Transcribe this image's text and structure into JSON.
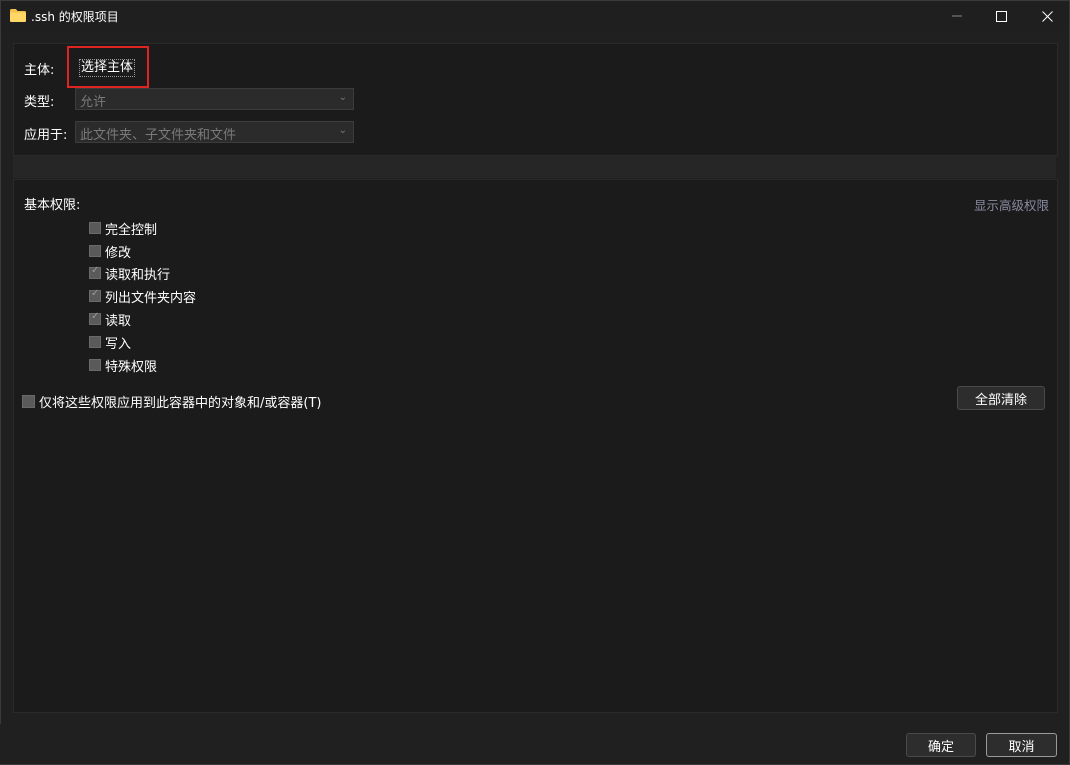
{
  "window": {
    "title": ".ssh 的权限项目",
    "folder_icon": "folder-icon"
  },
  "principal": {
    "label": "主体:",
    "link": "选择主体"
  },
  "type": {
    "label": "类型:",
    "value": "允许"
  },
  "applies_to": {
    "label": "应用于:",
    "value": "此文件夹、子文件夹和文件"
  },
  "basic": {
    "label": "基本权限:",
    "advanced_link": "显示高级权限",
    "permissions": [
      {
        "label": "完全控制",
        "checked": false
      },
      {
        "label": "修改",
        "checked": false
      },
      {
        "label": "读取和执行",
        "checked": true
      },
      {
        "label": "列出文件夹内容",
        "checked": true
      },
      {
        "label": "读取",
        "checked": true
      },
      {
        "label": "写入",
        "checked": false
      },
      {
        "label": "特殊权限",
        "checked": false
      }
    ]
  },
  "apply_only": {
    "label": "仅将这些权限应用到此容器中的对象和/或容器(T)",
    "checked": false
  },
  "buttons": {
    "clear_all": "全部清除",
    "ok": "确定",
    "cancel": "取消"
  },
  "colors": {
    "highlight": "#e02424",
    "background": "#202020"
  }
}
